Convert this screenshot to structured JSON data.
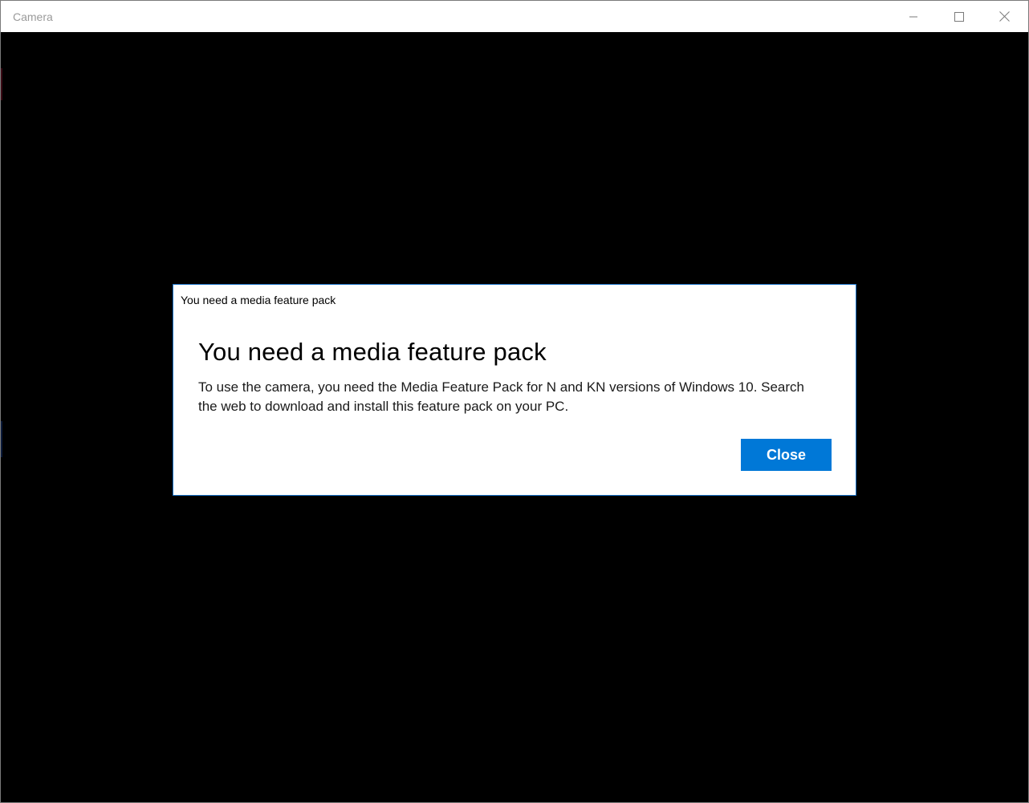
{
  "window": {
    "title": "Camera",
    "controls": {
      "minimize_icon": "minimize-icon",
      "maximize_icon": "maximize-icon",
      "close_icon": "close-icon"
    }
  },
  "dialog": {
    "caption": "You need a media feature pack",
    "heading": "You need a media feature pack",
    "message": "To use the camera, you need the Media Feature Pack for N and KN versions of Windows 10. Search the web to download and install this feature pack on your PC.",
    "close_label": "Close"
  },
  "colors": {
    "background": "#000000",
    "dialog_background": "#ffffff",
    "accent": "#0078d7",
    "dialog_border": "#1a73c8",
    "title_text": "#9a9a9a"
  }
}
